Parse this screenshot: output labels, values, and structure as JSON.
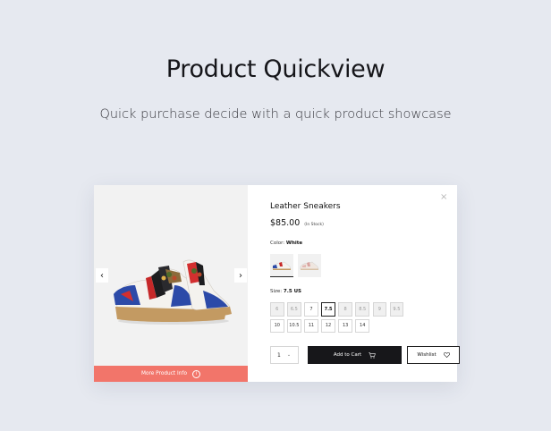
{
  "hero": {
    "title": "Product Quickview",
    "subtitle": "Quick purchase decide with a quick product showcase"
  },
  "quickview": {
    "close_symbol": "×",
    "media": {
      "prev_icon": "‹",
      "next_icon": "›",
      "more_info_label": "More Product Info",
      "more_info_icon": "i"
    },
    "product": {
      "name": "Leather Sneakers",
      "price": "$85.00",
      "stock": "(In Stock)"
    },
    "color": {
      "label": "Color:",
      "value": "White",
      "swatch_count": 2,
      "selected_index": 0
    },
    "size": {
      "label": "Size:",
      "value": "7.5 US",
      "options": [
        {
          "label": "6",
          "state": "unavailable"
        },
        {
          "label": "6.5",
          "state": "unavailable"
        },
        {
          "label": "7",
          "state": "available"
        },
        {
          "label": "7.5",
          "state": "selected"
        },
        {
          "label": "8",
          "state": "unavailable"
        },
        {
          "label": "8.5",
          "state": "unavailable"
        },
        {
          "label": "9",
          "state": "unavailable"
        },
        {
          "label": "9.5",
          "state": "unavailable"
        },
        {
          "label": "10",
          "state": "available"
        },
        {
          "label": "10.5",
          "state": "available"
        },
        {
          "label": "11",
          "state": "available"
        },
        {
          "label": "12",
          "state": "available"
        },
        {
          "label": "13",
          "state": "available"
        },
        {
          "label": "14",
          "state": "available"
        }
      ]
    },
    "actions": {
      "quantity": "1",
      "add_to_cart": "Add to Cart",
      "wishlist": "Wishlist"
    },
    "colors": {
      "accent": "#f2756a",
      "dark_button": "#17171a",
      "page_bg": "#e6e9f0"
    }
  }
}
